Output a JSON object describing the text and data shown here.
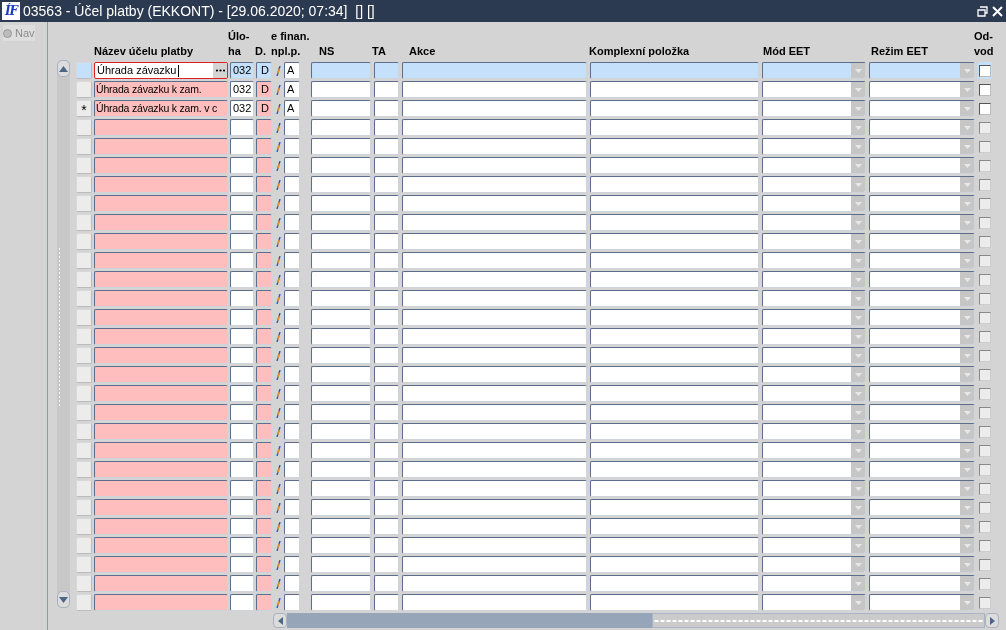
{
  "window": {
    "logo": "ÍF",
    "title": "03563 - Účel platby (EKKONT) - [29.06.2020; 07:34]  [] []"
  },
  "nav": {
    "label": "Nav",
    "disabled": true
  },
  "columns": [
    "Název účelu platby",
    "Úlo-\nha",
    "D.",
    "e finan.\nnpl.p.",
    "NS",
    "TA",
    "Akce",
    "Komplexní položka",
    "Mód EET",
    "Režim EET",
    "Od-\nvod"
  ],
  "rows": [
    {
      "selected": true,
      "editing": true,
      "name": "Úhrada závazku",
      "task": "032",
      "d": "D",
      "a": "A",
      "odvod_checked": false,
      "odvod_disabled": false
    },
    {
      "selected": false,
      "editing": false,
      "name": "Úhrada závazku k zam.",
      "task": "032",
      "d": "D",
      "a": "A",
      "odvod_checked": false,
      "odvod_disabled": false
    },
    {
      "selected": false,
      "editing": false,
      "marker": "*",
      "name": "Úhrada závazku k zam. v c",
      "task": "032",
      "d": "D",
      "a": "A",
      "odvod_checked": false,
      "odvod_disabled": false
    },
    {
      "selected": false,
      "editing": false,
      "odvod_checked": false,
      "odvod_disabled": true
    },
    {
      "selected": false,
      "editing": false,
      "odvod_checked": false,
      "odvod_disabled": true
    },
    {
      "selected": false,
      "editing": false,
      "odvod_checked": false,
      "odvod_disabled": true
    },
    {
      "selected": false,
      "editing": false,
      "odvod_checked": false,
      "odvod_disabled": true
    },
    {
      "selected": false,
      "editing": false,
      "odvod_checked": false,
      "odvod_disabled": true
    },
    {
      "selected": false,
      "editing": false,
      "odvod_checked": false,
      "odvod_disabled": true
    },
    {
      "selected": false,
      "editing": false,
      "odvod_checked": false,
      "odvod_disabled": true
    },
    {
      "selected": false,
      "editing": false,
      "odvod_checked": false,
      "odvod_disabled": true
    },
    {
      "selected": false,
      "editing": false,
      "odvod_checked": false,
      "odvod_disabled": true
    },
    {
      "selected": false,
      "editing": false,
      "odvod_checked": false,
      "odvod_disabled": true
    },
    {
      "selected": false,
      "editing": false,
      "odvod_checked": false,
      "odvod_disabled": true
    },
    {
      "selected": false,
      "editing": false,
      "odvod_checked": false,
      "odvod_disabled": true
    },
    {
      "selected": false,
      "editing": false,
      "odvod_checked": false,
      "odvod_disabled": true
    },
    {
      "selected": false,
      "editing": false,
      "odvod_checked": false,
      "odvod_disabled": true
    },
    {
      "selected": false,
      "editing": false,
      "odvod_checked": false,
      "odvod_disabled": true
    },
    {
      "selected": false,
      "editing": false,
      "odvod_checked": false,
      "odvod_disabled": true
    },
    {
      "selected": false,
      "editing": false,
      "odvod_checked": false,
      "odvod_disabled": true
    },
    {
      "selected": false,
      "editing": false,
      "odvod_checked": false,
      "odvod_disabled": true
    },
    {
      "selected": false,
      "editing": false,
      "odvod_checked": false,
      "odvod_disabled": true
    },
    {
      "selected": false,
      "editing": false,
      "odvod_checked": false,
      "odvod_disabled": true
    },
    {
      "selected": false,
      "editing": false,
      "odvod_checked": false,
      "odvod_disabled": true
    },
    {
      "selected": false,
      "editing": false,
      "odvod_checked": false,
      "odvod_disabled": true
    },
    {
      "selected": false,
      "editing": false,
      "odvod_checked": false,
      "odvod_disabled": true
    },
    {
      "selected": false,
      "editing": false,
      "odvod_checked": false,
      "odvod_disabled": true
    },
    {
      "selected": false,
      "editing": false,
      "odvod_checked": false,
      "odvod_disabled": true
    },
    {
      "selected": false,
      "editing": false,
      "odvod_checked": false,
      "odvod_disabled": true
    }
  ]
}
